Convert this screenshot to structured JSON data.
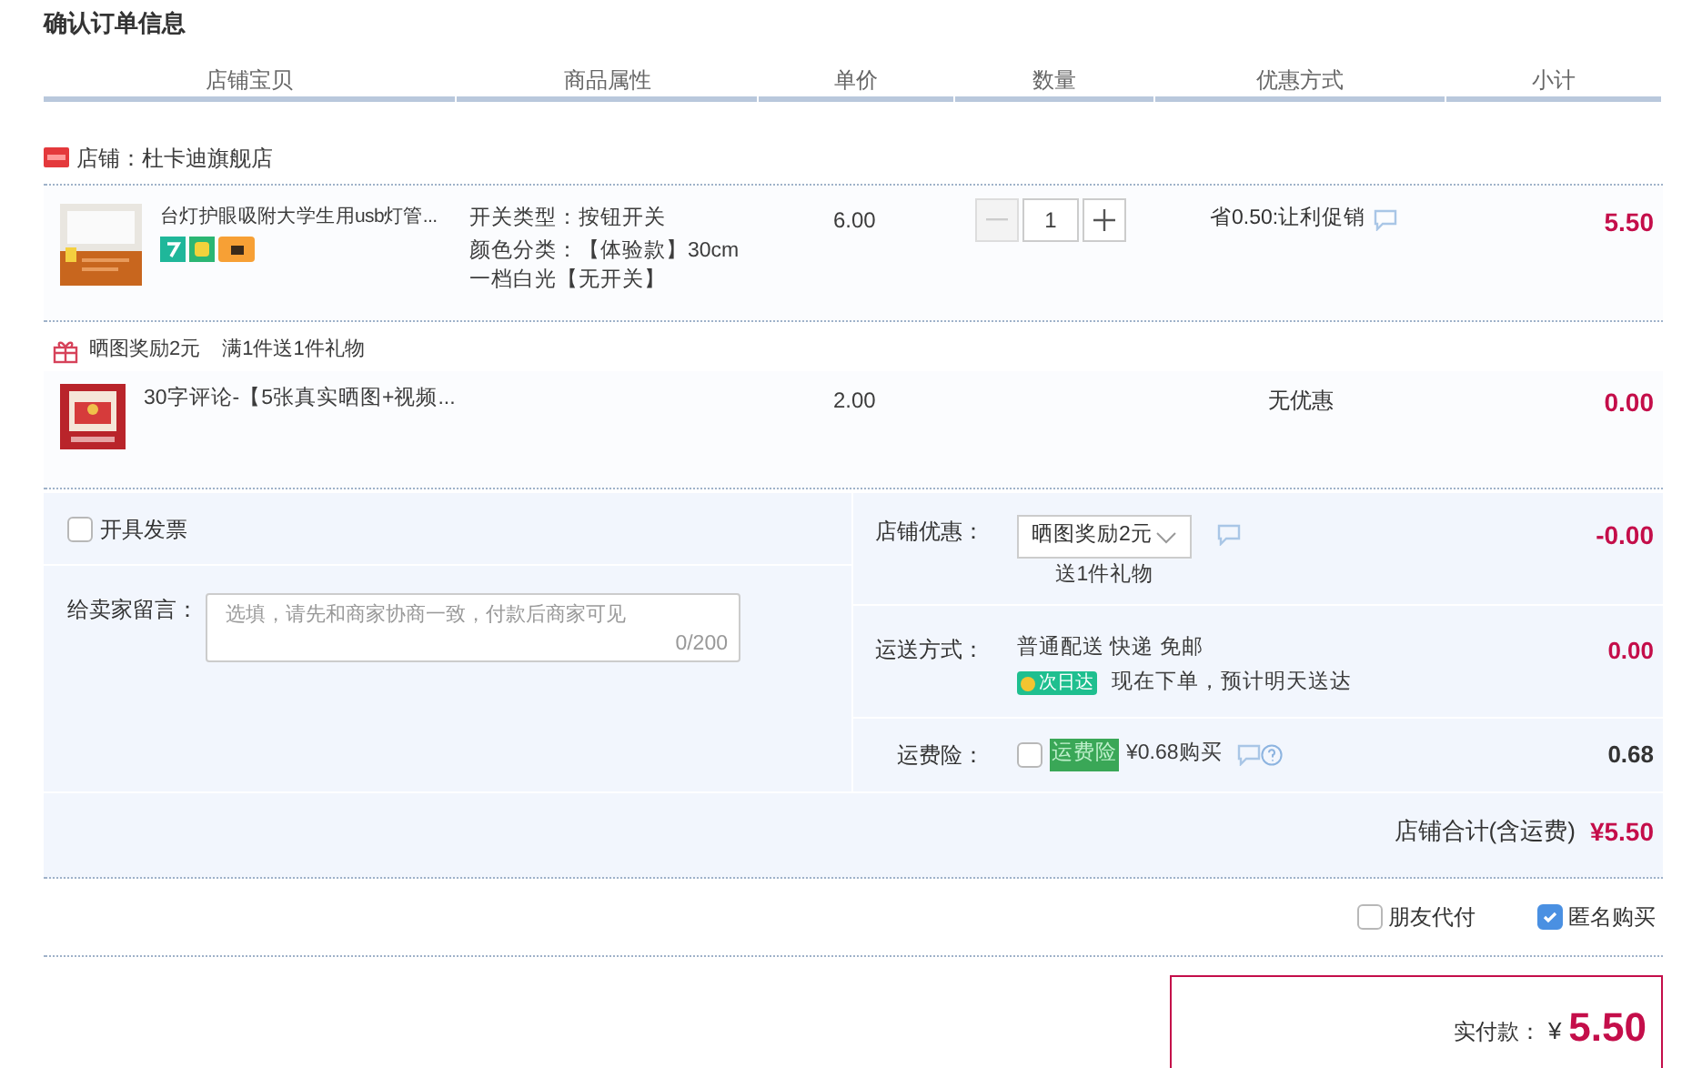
{
  "title": "确认订单信息",
  "table": {
    "columns": [
      "店铺宝贝",
      "商品属性",
      "单价",
      "数量",
      "优惠方式",
      "小计"
    ]
  },
  "shop": {
    "name": "店铺：杜卡迪旗舰店"
  },
  "items": [
    {
      "kind": "product",
      "title": "台灯护眼吸附大学生用usb灯管...",
      "properties": [
        "开关类型：按钮开关",
        "颜色分类：【体验款】30cm一档白光【无开关】"
      ],
      "price": "6.00",
      "quantity": {
        "value": "1",
        "decrease_disabled": true
      },
      "discount": "省0.50:让利促销",
      "subtotal": "5.50"
    },
    {
      "kind": "gift_header",
      "promo": "晒图奖励2元",
      "rule": "满1件送1件礼物"
    },
    {
      "kind": "gift",
      "title": "30字评论-【5张真实晒图+视频...",
      "price": "2.00",
      "discount": "无优惠",
      "subtotal": "0.00"
    }
  ],
  "invoice": {
    "label": "开具发票",
    "checked": false
  },
  "message": {
    "label": "给卖家留言：",
    "placeholder": "选填，请先和商家协商一致，付款后商家可见",
    "counter": "0/200"
  },
  "shop_discount": {
    "label": "店铺优惠：",
    "value": "晒图奖励2元",
    "note": "送1件礼物",
    "amount": "-0.00"
  },
  "shipping": {
    "label": "运送方式：",
    "method": "普通配送 快递 免邮",
    "badge": "次日达",
    "note": "现在下单，预计明天送达",
    "amount": "0.00"
  },
  "insurance": {
    "label": "运费险：",
    "checked": false,
    "tag": "运费险",
    "price": "¥0.68购买",
    "amount": "0.68"
  },
  "shop_total": {
    "label": "店铺合计(含运费)",
    "amount": "¥5.50"
  },
  "options": [
    {
      "label": "朋友代付",
      "checked": false
    },
    {
      "label": "匿名购买",
      "checked": true
    }
  ],
  "payment": {
    "label": "实付款：",
    "currency": "¥",
    "amount": "5.50"
  }
}
